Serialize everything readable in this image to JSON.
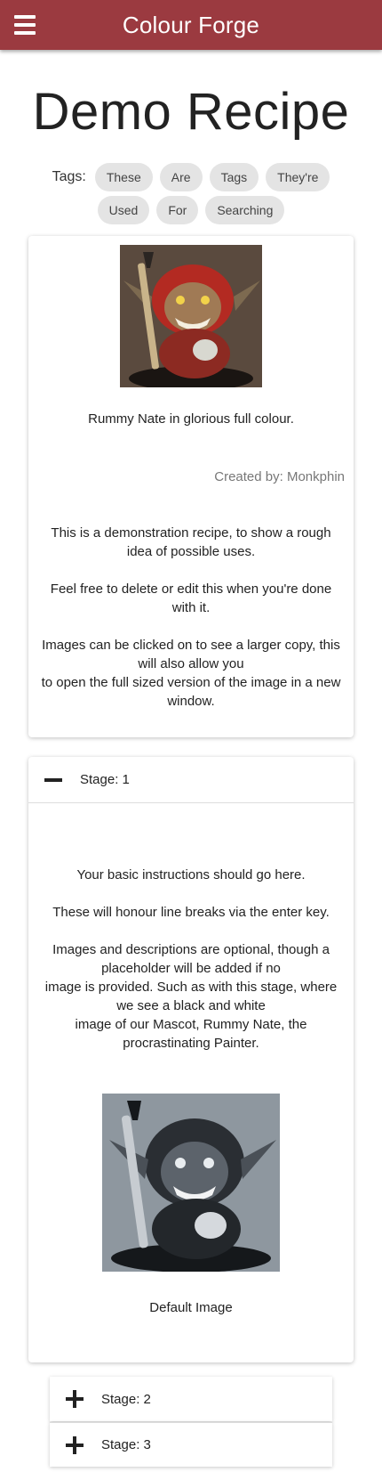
{
  "appbar": {
    "title": "Colour Forge",
    "menu_icon": "hamburger-menu-icon"
  },
  "recipe": {
    "title": "Demo Recipe",
    "tags_label": "Tags:",
    "tags": [
      "These",
      "Are",
      "Tags",
      "They're",
      "Used",
      "For",
      "Searching"
    ],
    "main_image_caption": "Rummy Nate in glorious full colour.",
    "created_by": "Created by: Monkphin",
    "description": [
      "This is a demonstration recipe, to show a rough idea of possible uses.",
      "Feel free to delete or edit this when you're done with it.",
      "Images can be clicked on to see a larger copy, this will also allow you",
      "to open the full sized version of the image in a new window."
    ]
  },
  "stages": [
    {
      "label": "Stage: 1",
      "expanded": true,
      "instructions": [
        "Your basic instructions should go here.",
        "These will honour line breaks via the enter key.",
        "Images and descriptions are optional, though a placeholder will be added if no",
        "image is provided. Such as with this stage, where we see a black and white",
        "image of our Mascot, Rummy Nate, the procrastinating Painter."
      ],
      "image_caption": "Default Image"
    },
    {
      "label": "Stage: 2",
      "expanded": false
    },
    {
      "label": "Stage: 3",
      "expanded": false
    }
  ],
  "colors": {
    "appbar": "#9b3a40",
    "chip": "#e4e4e4"
  }
}
